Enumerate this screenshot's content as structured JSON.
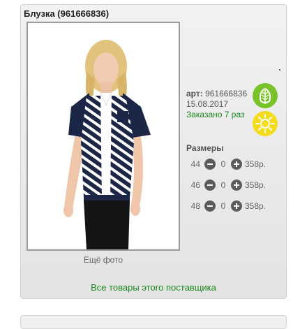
{
  "product": {
    "title": "Блузка (961666836)",
    "more_photos": "Ещё фото",
    "art_label": "арт:",
    "art_value": "961666836",
    "date": "15.08.2017",
    "ordered": "Заказано 7 раз"
  },
  "badges": {
    "eco_icon": "leaf-icon",
    "eco_color": "#79c32a",
    "summer_icon": "sun-icon",
    "summer_color": "#f4dc1c"
  },
  "sizes": {
    "title": "Размеры",
    "rows": [
      {
        "size": "44",
        "qty": "0",
        "price": "358р."
      },
      {
        "size": "46",
        "qty": "0",
        "price": "358р."
      },
      {
        "size": "48",
        "qty": "0",
        "price": "358р."
      }
    ]
  },
  "supplier_link": "Все товары этого поставщика",
  "colors": {
    "link_green": "#1a8a1a"
  }
}
